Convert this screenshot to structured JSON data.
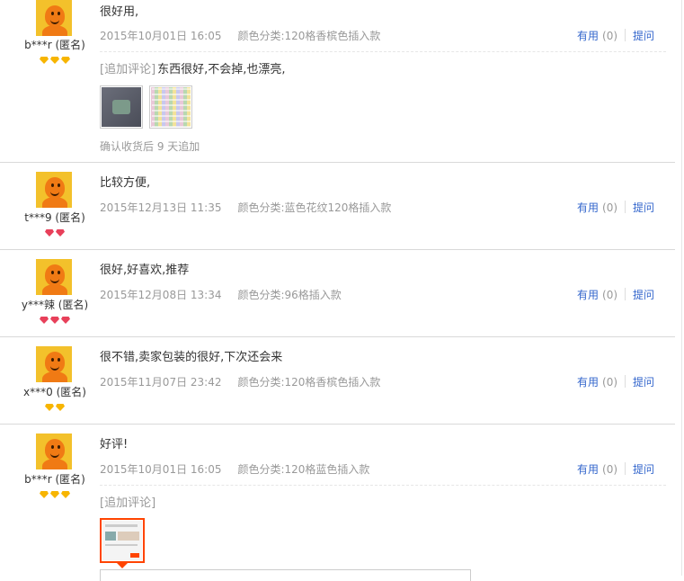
{
  "reviews": [
    {
      "user": "b***r (匿名)",
      "badges": [
        "gold",
        "gold",
        "gold"
      ],
      "content": "很好用,",
      "date": "2015年10月01日 16:05",
      "sku": "颜色分类:120格香槟色插入款",
      "useful_label": "有用",
      "useful_count": "(0)",
      "ask_label": "提问",
      "append_tag": "[追加评论]",
      "append_text": "东西很好,不会掉,也漂亮,",
      "append_confirm": "确认收货后 9 天追加"
    },
    {
      "user": "t***9 (匿名)",
      "badges": [
        "red",
        "red"
      ],
      "content": "比较方便,",
      "date": "2015年12月13日 11:35",
      "sku": "颜色分类:蓝色花纹120格插入款",
      "useful_label": "有用",
      "useful_count": "(0)",
      "ask_label": "提问"
    },
    {
      "user": "y***辣 (匿名)",
      "badges": [
        "red",
        "red",
        "red"
      ],
      "content": "很好,好喜欢,推荐",
      "date": "2015年12月08日 13:34",
      "sku": "颜色分类:96格插入款",
      "useful_label": "有用",
      "useful_count": "(0)",
      "ask_label": "提问"
    },
    {
      "user": "x***0 (匿名)",
      "badges": [
        "gold",
        "gold"
      ],
      "content": "很不错,卖家包装的很好,下次还会来",
      "date": "2015年11月07日 23:42",
      "sku": "颜色分类:120格香槟色插入款",
      "useful_label": "有用",
      "useful_count": "(0)",
      "ask_label": "提问"
    },
    {
      "user": "b***r (匿名)",
      "badges": [
        "gold",
        "gold",
        "gold"
      ],
      "content": "好评!",
      "date": "2015年10月01日 16:05",
      "sku": "颜色分类:120格蓝色插入款",
      "useful_label": "有用",
      "useful_count": "(0)",
      "ask_label": "提问",
      "append_tag": "[追加评论]"
    }
  ],
  "colors": {
    "link": "#3366cc",
    "muted": "#999999",
    "badge_gold": "#f7b500",
    "badge_red": "#e8405a",
    "avatar_bg": "#f3c12b",
    "active_thumb": "#ff4400"
  }
}
